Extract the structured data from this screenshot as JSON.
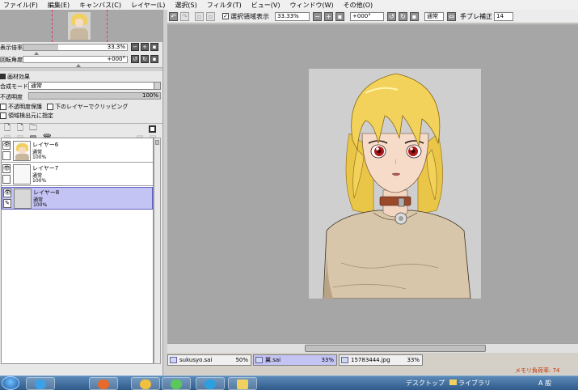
{
  "menu": [
    "ファイル(F)",
    "編集(E)",
    "キャンバス(C)",
    "レイヤー(L)",
    "選択(S)",
    "フィルタ(T)",
    "ビュー(V)",
    "ウィンドウ(W)",
    "その他(O)"
  ],
  "navigator": {
    "zoom_label": "表示倍率",
    "zoom_value": "33.3%",
    "rotation_label": "回転角度",
    "rotation_value": "+000°",
    "zoom_fraction": 0.333
  },
  "layer_panel": {
    "texture_effect_label": "画材効果",
    "blend_mode_label": "合成モード",
    "blend_mode_value": "通常",
    "opacity_label": "不透明度",
    "opacity_value": "100%",
    "preserve_opacity_label": "不透明度保護",
    "clipping_label": "下のレイヤーでクリッピング",
    "selection_source_label": "領域検出元に指定"
  },
  "layers": [
    {
      "name": "レイヤー6",
      "mode": "通常",
      "opacity": "100%",
      "visible": true,
      "selected": false
    },
    {
      "name": "レイヤー7",
      "mode": "通常",
      "opacity": "100%",
      "visible": true,
      "selected": false
    },
    {
      "name": "レイヤー8",
      "mode": "通常",
      "opacity": "100%",
      "visible": true,
      "selected": true
    }
  ],
  "toolbar": {
    "show_selection_label": "選択領域表示",
    "zoom_value": "33.33%",
    "rotation_value": "+000°",
    "blend_value": "通常",
    "stabilizer_label": "手ブレ補正",
    "stabilizer_value": "14"
  },
  "file_tabs": [
    {
      "name": "sukusyo.sai",
      "zoom": "50%",
      "active": false
    },
    {
      "name": "翼.sai",
      "zoom": "33%",
      "active": true
    },
    {
      "name": "15783444.jpg",
      "zoom": "33%",
      "active": false
    }
  ],
  "memory_label": "メモリ負荷率: 74",
  "taskbar": {
    "desktop_label": "デスクトップ",
    "library_label": "ライブラリ",
    "tray_text": "A 般"
  },
  "colors": {
    "canvas_bg": "#a6a6a6",
    "selected_layer": "#c4c4f4",
    "hair": "#f2d25a",
    "shirt": "#d4c3a9",
    "collar": "#9a4a2a"
  }
}
